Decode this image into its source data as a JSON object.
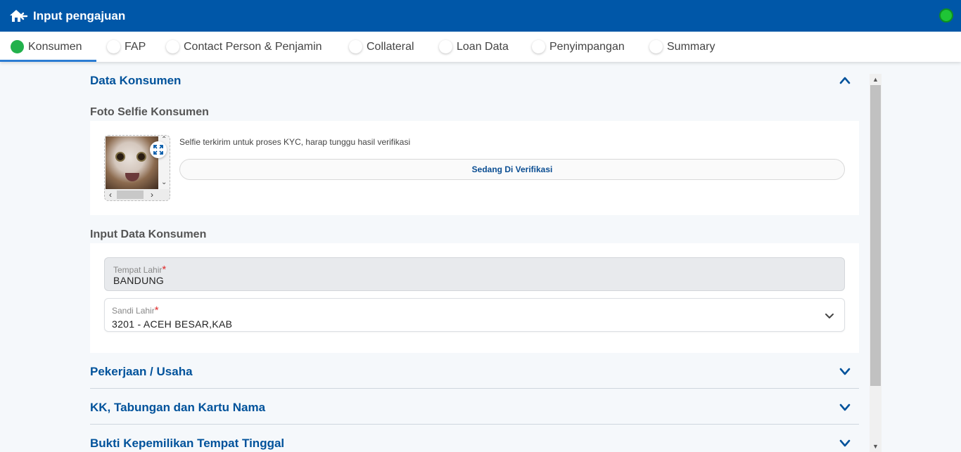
{
  "header": {
    "title": "Input pengajuan",
    "status_color": "#1fc536"
  },
  "tabs": [
    {
      "label": "Konsumen",
      "active": true
    },
    {
      "label": "FAP",
      "active": false
    },
    {
      "label": "Contact Person & Penjamin",
      "active": false
    },
    {
      "label": "Collateral",
      "active": false
    },
    {
      "label": "Loan Data",
      "active": false
    },
    {
      "label": "Penyimpangan",
      "active": false
    },
    {
      "label": "Summary",
      "active": false
    }
  ],
  "data_konsumen": {
    "title": "Data Konsumen",
    "expanded": true,
    "foto": {
      "title": "Foto Selfie Konsumen",
      "message": "Selfie terkirim untuk proses KYC, harap tunggu hasil verifikasi",
      "status_label": "Sedang Di Verifikasi"
    },
    "input": {
      "title": "Input Data Konsumen",
      "tempat_lahir": {
        "label": "Tempat Lahir",
        "required_mark": "*",
        "value": "BANDUNG"
      },
      "sandi_lahir": {
        "label": "Sandi Lahir",
        "required_mark": "*",
        "value": "3201 - ACEH BESAR,KAB"
      }
    }
  },
  "collapsed_sections": [
    {
      "title": "Pekerjaan / Usaha"
    },
    {
      "title": "KK, Tabungan dan Kartu Nama"
    },
    {
      "title": "Bukti Kepemilikan Tempat Tinggal"
    }
  ],
  "colors": {
    "primary": "#0057a8",
    "active_tab_dot": "#22b14c",
    "section_title": "#00529b",
    "required": "#e02b2b"
  }
}
